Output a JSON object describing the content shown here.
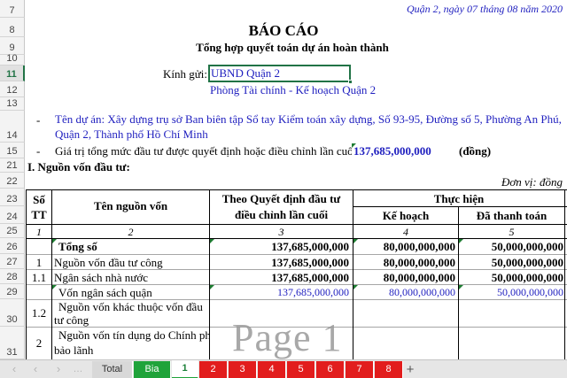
{
  "rows": [
    {
      "label": "7",
      "top": 0
    },
    {
      "label": "8",
      "top": 0
    },
    {
      "label": "9",
      "top": 0
    },
    {
      "label": "10",
      "top": 0
    },
    {
      "label": "11",
      "top": 0
    },
    {
      "label": "12",
      "top": 0
    },
    {
      "label": "13",
      "top": 0
    },
    {
      "label": "14",
      "top": 0
    },
    {
      "label": "15",
      "top": 0
    },
    {
      "label": "21",
      "top": 0
    },
    {
      "label": "22",
      "top": 0
    },
    {
      "label": "23",
      "top": 0
    },
    {
      "label": "24",
      "top": 0
    },
    {
      "label": "25",
      "top": 0
    },
    {
      "label": "26",
      "top": 0
    },
    {
      "label": "27",
      "top": 0
    },
    {
      "label": "28",
      "top": 0
    },
    {
      "label": "29",
      "top": 0
    },
    {
      "label": "30",
      "top": 0
    },
    {
      "label": "31",
      "top": 0
    }
  ],
  "header": {
    "date_line": "Quận 2, ngày 07 tháng 08 năm 2020",
    "title": "BÁO CÁO",
    "subtitle": "Tổng hợp quyết toán dự án hoàn thành",
    "kinh_gui_label": "Kính gửi:",
    "recipient_1": "UBND Quận 2",
    "recipient_2": "Phòng Tài chính - Kế hoạch Quận 2"
  },
  "project": {
    "dash": "-",
    "name_line_1": "Tên dự án: Xây dựng trụ sở Ban biên tập Sổ tay Kiểm toán xây dựng, Số 93-95, Đường số 5, Phường An Phú,",
    "name_line_2": "Quận 2, Thành phố Hồ Chí Minh",
    "value_label": "Giá trị tổng mức đầu tư được quyết định hoặc điều chỉnh lần cuối:",
    "value": "137,685,000,000",
    "unit": "(đồng)"
  },
  "section": {
    "title": "I.  Nguồn vốn đầu tư:",
    "unit_note": "Đơn vị: đồng"
  },
  "table": {
    "col_stt": "Số TT",
    "col_stt_1": "Số",
    "col_stt_2": "TT",
    "col_name": "Tên nguồn vốn",
    "col_qd_1": "Theo Quyết định đầu tư",
    "col_qd_2": "điều chỉnh lần cuối",
    "col_th": "Thực hiện",
    "col_kh": "Kế hoạch",
    "col_tt": "Đã thanh toán",
    "idx": [
      "1",
      "2",
      "3",
      "4",
      "5"
    ],
    "rows": [
      {
        "stt": "",
        "name": "Tổng số",
        "qd": "137,685,000,000",
        "kh": "80,000,000,000",
        "tt": "50,000,000,000"
      },
      {
        "stt": "1",
        "name": "Nguồn vốn đầu tư công",
        "qd": "137,685,000,000",
        "kh": "80,000,000,000",
        "tt": "50,000,000,000"
      },
      {
        "stt": "1.1",
        "name": "Ngân sách nhà nước",
        "qd": "137,685,000,000",
        "kh": "80,000,000,000",
        "tt": "50,000,000,000"
      },
      {
        "stt": "",
        "name": "Vốn ngân sách quận",
        "qd": "137,685,000,000",
        "kh": "80,000,000,000",
        "tt": "50,000,000,000"
      },
      {
        "stt": "1.2",
        "name_1": "Nguồn vốn khác thuộc vốn đầu",
        "name_2": "tư công"
      },
      {
        "stt": "2",
        "name_1": "Nguồn vốn tín dụng do Chính phủ",
        "name_2": "bảo lãnh"
      }
    ]
  },
  "watermark": "Page 1",
  "tabs": {
    "total": "Total",
    "bia": "Bia",
    "sheets": [
      "1",
      "2",
      "3",
      "4",
      "5",
      "6",
      "7",
      "8"
    ],
    "add": "+"
  },
  "colors": {
    "bia_tab": "#1fa33a",
    "red_tab": "#e21d1d",
    "total_tab": "#d8d8d8",
    "selection": "#217346"
  }
}
